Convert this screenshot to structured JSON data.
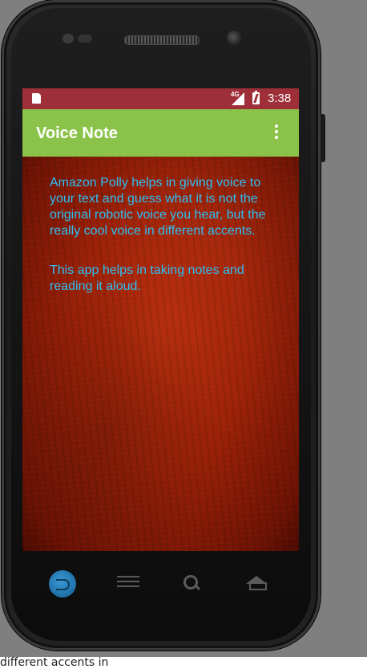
{
  "status_bar": {
    "network": "4G",
    "time": "3:38"
  },
  "app_bar": {
    "title": "Voice Note"
  },
  "content": {
    "paragraph_1": "Amazon Polly helps in giving voice to your text and guess what it is not the original robotic voice you hear, but the really cool voice in different accents.",
    "paragraph_2": "This app helps in taking notes and reading it aloud."
  },
  "colors": {
    "status_bar_bg": "#9e2f38",
    "app_bar_bg": "#8bc34a",
    "body_text": "#2ebff5"
  },
  "nav_bar": {
    "icons": [
      "back-icon",
      "menu-icon",
      "search-icon",
      "home-icon"
    ]
  },
  "footer": {
    "cut_text": "different accents in"
  }
}
